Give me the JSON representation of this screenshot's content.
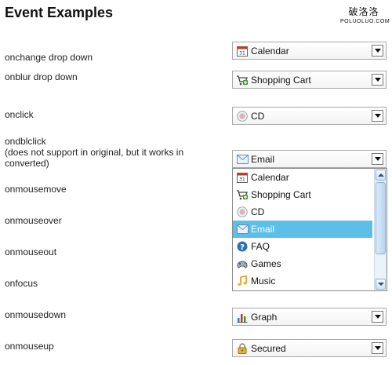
{
  "page": {
    "title": "Event Examples",
    "logo_cn": "破洛洛",
    "logo_en": "POLUOLUO.COM"
  },
  "rows": [
    {
      "label": "onchange drop down",
      "value": "Calendar",
      "icon": "calendar-icon"
    },
    {
      "label": "onblur drop down",
      "value": "Shopping Cart",
      "icon": "shopping-cart-icon"
    },
    {
      "label": "onclick",
      "value": "CD",
      "icon": "cd-icon"
    },
    {
      "label_line1": "ondblclick",
      "label_line2": "(does not support in original, but it works in",
      "label_line3": "converted)",
      "value": "Email",
      "icon": "email-icon"
    },
    {
      "label": "onmousemove"
    },
    {
      "label": "onmouseover"
    },
    {
      "label": "onmouseout"
    },
    {
      "label": "onfocus"
    },
    {
      "label": "onmousedown",
      "value": "Graph",
      "icon": "graph-icon"
    },
    {
      "label": "onmouseup",
      "value": "Secured",
      "icon": "lock-icon"
    }
  ],
  "open_list": {
    "options": [
      {
        "label": "Calendar",
        "icon": "calendar-icon"
      },
      {
        "label": "Shopping Cart",
        "icon": "shopping-cart-icon"
      },
      {
        "label": "CD",
        "icon": "cd-icon"
      },
      {
        "label": "Email",
        "icon": "email-icon",
        "selected": true
      },
      {
        "label": "FAQ",
        "icon": "faq-icon"
      },
      {
        "label": "Games",
        "icon": "games-icon"
      },
      {
        "label": "Music",
        "icon": "music-icon"
      }
    ],
    "selected_color": "#5bbfe8"
  }
}
